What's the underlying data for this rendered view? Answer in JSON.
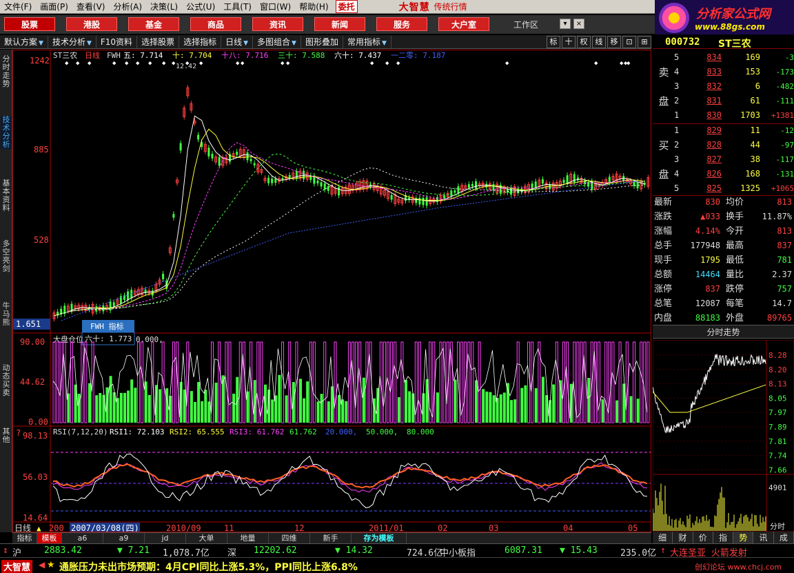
{
  "menu": [
    "文件(F)",
    "画面(P)",
    "查看(V)",
    "分析(A)",
    "决策(L)",
    "公式(U)",
    "工具(T)",
    "窗口(W)",
    "帮助(H)"
  ],
  "weituo": "委托",
  "brand": {
    "name": "大智慧",
    "tagline": "传统行情"
  },
  "logo": {
    "title": "分析家公式网",
    "url": "www.88gs.com"
  },
  "nav": [
    "股票",
    "港股",
    "基金",
    "商品",
    "资讯",
    "新闻",
    "服务",
    "大户室"
  ],
  "workspace": "工作区",
  "toolbar": {
    "items": [
      "默认方案",
      "技术分析",
      "F10资料",
      "选择股票",
      "选择指标",
      "日线",
      "多图组合",
      "图形叠加",
      "常用指标"
    ],
    "buttons": [
      "标",
      "十",
      "权",
      "线",
      "移",
      "⊡",
      "⊞"
    ]
  },
  "left_tabs": [
    "分时走势",
    "技术分析",
    "基本资料",
    "多空亮剑",
    "牛马熊",
    "动态买卖",
    "其他"
  ],
  "stock": {
    "code": "000732",
    "name": "ST三农"
  },
  "chart": {
    "header": {
      "name": "ST三农",
      "period": "日线",
      "indicator": "FWH",
      "ma": [
        {
          "label": "五:",
          "value": "7.714",
          "color": "#ffffff"
        },
        {
          "label": "十:",
          "value": "7.704",
          "color": "#ffff40"
        },
        {
          "label": "十八:",
          "value": "7.716",
          "color": "#ff40ff"
        },
        {
          "label": "三十:",
          "value": "7.588",
          "color": "#40ff40"
        },
        {
          "label": "六十:",
          "value": "7.437",
          "color": "#ffffff"
        },
        {
          "label": "一二零:",
          "value": "7.187",
          "color": "#4060ff"
        }
      ]
    },
    "price_ticks": [
      "1242",
      "885",
      "528"
    ],
    "cur_low": "1.651",
    "peak_label": "12.42",
    "tooltip": {
      "title": "FWH 指标",
      "line": "六十:  1.773"
    },
    "panel2": {
      "title": "大盘仓位",
      "line_value": "0.000,",
      "ticks": [
        "90.00",
        "44.62",
        "0.00"
      ]
    },
    "panel3": {
      "title": "RSI(7,12,20)",
      "items": [
        {
          "label": "RSI1:",
          "value": "72.103",
          "color": "#ffffff"
        },
        {
          "label": "RSI2:",
          "value": "65.555",
          "color": "#ffff40"
        },
        {
          "label": "RSI3:",
          "value": "61.762",
          "color": "#ff40ff"
        },
        {
          "label": "",
          "value": "61.762",
          "color": "#40ff40"
        },
        {
          "label": "",
          "value": "20.000,",
          "color": "#4060ff"
        },
        {
          "label": "",
          "value": "50.000,",
          "color": "#40ff40"
        },
        {
          "label": "",
          "value": "80.000",
          "color": "#40ff40"
        }
      ],
      "ticks": [
        "98.13",
        "56.03",
        "14.64"
      ]
    },
    "x_labels": [
      "200",
      "2007/03/08(四)",
      "2010/09",
      "11",
      "12",
      "2011/01",
      "02",
      "03",
      "04",
      "05"
    ],
    "period_label": "日线"
  },
  "template_tabs": [
    "指标",
    "模板",
    "a6",
    "a9",
    "jd",
    "大单",
    "地量",
    "四维",
    "新手",
    "存为模板"
  ],
  "orderbook": {
    "sell_label": [
      "卖",
      "盘"
    ],
    "buy_label": [
      "买",
      "盘"
    ],
    "sell": [
      {
        "lvl": "5",
        "price": "834",
        "vol": "169",
        "chg": "-3"
      },
      {
        "lvl": "4",
        "price": "833",
        "vol": "153",
        "chg": "-173"
      },
      {
        "lvl": "3",
        "price": "832",
        "vol": "6",
        "chg": "-482"
      },
      {
        "lvl": "2",
        "price": "831",
        "vol": "61",
        "chg": "-111"
      },
      {
        "lvl": "1",
        "price": "830",
        "vol": "1703",
        "chg": "+1381"
      }
    ],
    "buy": [
      {
        "lvl": "1",
        "price": "829",
        "vol": "11",
        "chg": "-12"
      },
      {
        "lvl": "2",
        "price": "828",
        "vol": "44",
        "chg": "-97"
      },
      {
        "lvl": "3",
        "price": "827",
        "vol": "38",
        "chg": "-117"
      },
      {
        "lvl": "4",
        "price": "826",
        "vol": "168",
        "chg": "-131"
      },
      {
        "lvl": "5",
        "price": "825",
        "vol": "1325",
        "chg": "+1065"
      }
    ]
  },
  "stats": [
    {
      "k1": "最新",
      "v1": "830",
      "c1": "red",
      "k2": "均价",
      "v2": "813",
      "c2": "red"
    },
    {
      "k1": "涨跌",
      "v1": "▲033",
      "c1": "red",
      "k2": "换手",
      "v2": "11.87%",
      "c2": "wht"
    },
    {
      "k1": "涨幅",
      "v1": "4.14%",
      "c1": "red",
      "k2": "今开",
      "v2": "813",
      "c2": "red"
    },
    {
      "k1": "总手",
      "v1": "177948",
      "c1": "wht",
      "k2": "最高",
      "v2": "837",
      "c2": "red"
    },
    {
      "k1": "现手",
      "v1": "1795",
      "c1": "yel",
      "k2": "最低",
      "v2": "781",
      "c2": "grn"
    },
    {
      "k1": "总额",
      "v1": "14464",
      "c1": "cyn",
      "k2": "量比",
      "v2": "2.37",
      "c2": "wht"
    },
    {
      "k1": "涨停",
      "v1": "837",
      "c1": "red",
      "k2": "跌停",
      "v2": "757",
      "c2": "grn"
    },
    {
      "k1": "总笔",
      "v1": "12087",
      "c1": "wht",
      "k2": "每笔",
      "v2": "14.7",
      "c2": "wht"
    },
    {
      "k1": "内盘",
      "v1": "88183",
      "c1": "grn",
      "k2": "外盘",
      "v2": "89765",
      "c2": "red"
    }
  ],
  "minute_chart": {
    "title": "分时走势",
    "ticks": [
      "8.28",
      "8.20",
      "8.13",
      "8.05",
      "7.97",
      "7.89",
      "7.81",
      "7.74",
      "7.66"
    ],
    "vol_tick": "4901",
    "x_label": "分时"
  },
  "bottom_tabs": [
    "细",
    "财",
    "价",
    "指",
    "势",
    "讯",
    "成"
  ],
  "ticker": {
    "sh_label": "沪",
    "sh_index": "2883.42",
    "sh_chg": "▼ 7.21",
    "sh_amt": "1,078.7亿",
    "sz_label": "深",
    "sz_index": "12202.62",
    "sz_chg": "▼ 14.32",
    "sz_amt": "724.6亿",
    "zx_label": "中小板指",
    "zx_index": "6087.31",
    "zx_chg": "▼ 15.43",
    "zx_amt": "235.0亿",
    "alert": "大连圣亚 火箭发射"
  },
  "status": {
    "logo": "大智慧",
    "news": "通胀压力未出市场预期：4月CPI同比上涨5.3%，PPI同比上涨6.8%",
    "site": "创幻论坛 www.chcj.com"
  }
}
